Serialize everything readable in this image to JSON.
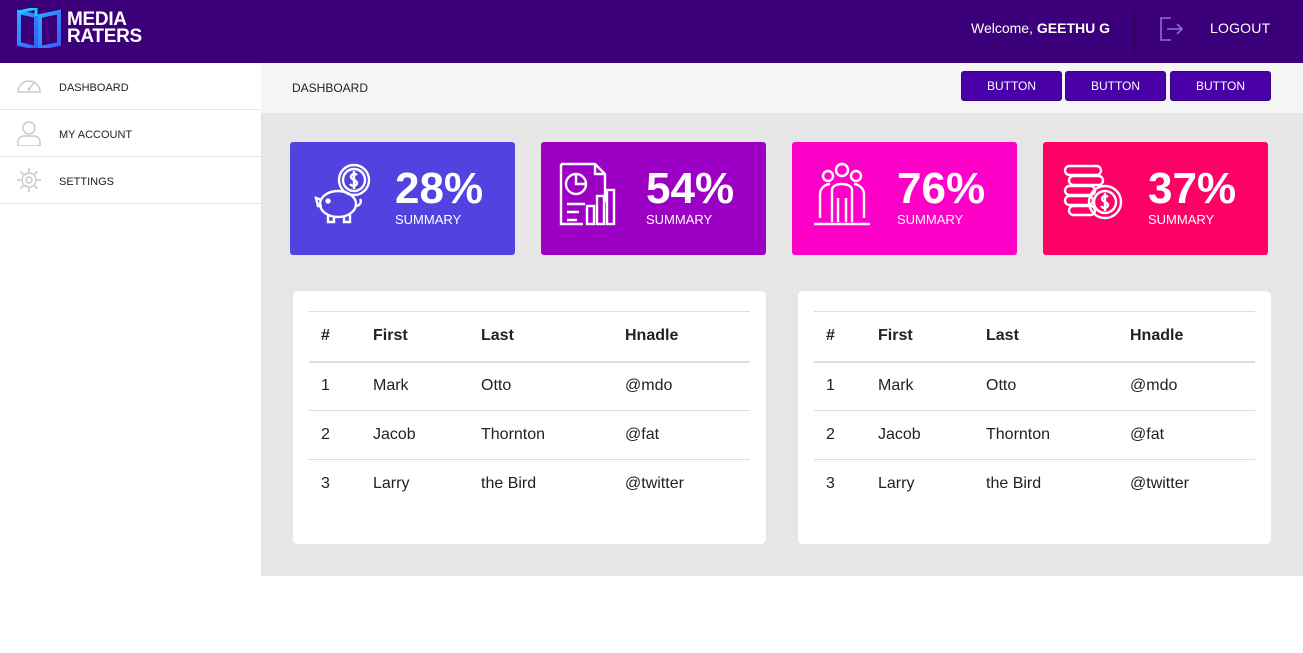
{
  "brand": {
    "line1": "MEDIA",
    "line2": "RATERS"
  },
  "header": {
    "welcome_prefix": "Welcome,",
    "user_name": "GEETHU G",
    "logout_label": "LOGOUT"
  },
  "sidebar": {
    "items": [
      {
        "label": "DASHBOARD",
        "icon": "speedometer-icon"
      },
      {
        "label": "MY ACCOUNT",
        "icon": "user-icon"
      },
      {
        "label": "SETTINGS",
        "icon": "gear-icon"
      }
    ]
  },
  "subbar": {
    "breadcrumb": "DASHBOARD",
    "buttons": [
      "BUTTON",
      "BUTTON",
      "BUTTON"
    ]
  },
  "cards": [
    {
      "value": "28%",
      "label": "SUMMARY",
      "color": "#5243e0",
      "icon": "piggy-bank-icon"
    },
    {
      "value": "54%",
      "label": "SUMMARY",
      "color": "#9c00c4",
      "icon": "report-chart-icon"
    },
    {
      "value": "76%",
      "label": "SUMMARY",
      "color": "#ff00c8",
      "icon": "people-group-icon"
    },
    {
      "value": "37%",
      "label": "SUMMARY",
      "color": "#ff0066",
      "icon": "coins-stack-icon"
    }
  ],
  "tables": [
    {
      "headers": [
        "#",
        "First",
        "Last",
        "Hnadle"
      ],
      "rows": [
        [
          "1",
          "Mark",
          "Otto",
          "@mdo"
        ],
        [
          "2",
          "Jacob",
          "Thornton",
          "@fat"
        ],
        [
          "3",
          "Larry",
          "the Bird",
          "@twitter"
        ]
      ]
    },
    {
      "headers": [
        "#",
        "First",
        "Last",
        "Hnadle"
      ],
      "rows": [
        [
          "1",
          "Mark",
          "Otto",
          "@mdo"
        ],
        [
          "2",
          "Jacob",
          "Thornton",
          "@fat"
        ],
        [
          "3",
          "Larry",
          "the Bird",
          "@twitter"
        ]
      ]
    }
  ],
  "colors": {
    "topbar": "#3b0079",
    "button": "#4a00a8",
    "main_bg": "#e6e6e6"
  }
}
